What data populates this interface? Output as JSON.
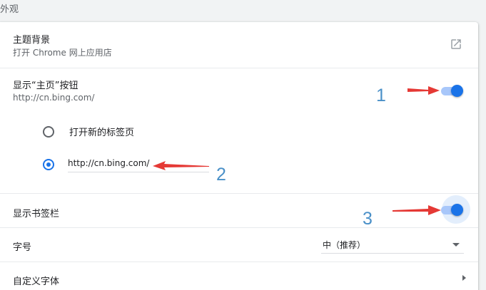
{
  "section": {
    "title": "外观"
  },
  "theme": {
    "label": "主题背景",
    "sublabel": "打开 Chrome 网上应用店",
    "icon": "open-in-new-icon"
  },
  "home_button": {
    "label": "显示“主页”按钮",
    "sublabel": "http://cn.bing.com/",
    "enabled": true,
    "options": [
      {
        "label": "打开新的标签页",
        "selected": false
      },
      {
        "label": "",
        "selected": true
      }
    ],
    "url_value": "http://cn.bing.com/"
  },
  "bookmarks_bar": {
    "label": "显示书签栏",
    "enabled": true
  },
  "font_size": {
    "label": "字号",
    "selected": "中（推荐）"
  },
  "custom_fonts": {
    "label": "自定义字体",
    "icon": "chevron-right-icon"
  },
  "annotations": {
    "one": "1",
    "two": "2",
    "three": "3",
    "arrow_color": "#e53935",
    "number_color": "#4a90c8"
  },
  "colors": {
    "accent": "#1a73e8",
    "toggle_track": "#a8c7fa"
  }
}
